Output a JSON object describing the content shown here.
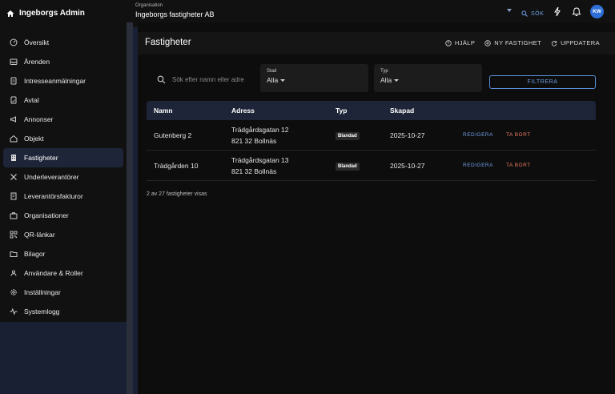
{
  "app": {
    "name": "Ingeborgs Admin"
  },
  "org": {
    "label": "Organisation",
    "name": "Ingeborgs fastigheter AB"
  },
  "topbar": {
    "search_label": "SÖK",
    "avatar_initials": "KW"
  },
  "sidebar": {
    "items": [
      {
        "label": "Översikt",
        "icon": "dashboard-icon"
      },
      {
        "label": "Ärenden",
        "icon": "inbox-icon"
      },
      {
        "label": "Intresseanmälningar",
        "icon": "document-icon"
      },
      {
        "label": "Avtal",
        "icon": "contract-icon"
      },
      {
        "label": "Annonser",
        "icon": "megaphone-icon"
      },
      {
        "label": "Objekt",
        "icon": "home-icon"
      },
      {
        "label": "Fastigheter",
        "icon": "building-icon",
        "active": true
      },
      {
        "label": "Underleverantörer",
        "icon": "tools-icon"
      },
      {
        "label": "Leverantörsfakturor",
        "icon": "invoice-icon"
      },
      {
        "label": "Organisationer",
        "icon": "briefcase-icon"
      },
      {
        "label": "QR-länkar",
        "icon": "qr-code-icon"
      },
      {
        "label": "Bilagor",
        "icon": "folder-icon"
      },
      {
        "label": "Användare & Roller",
        "icon": "users-icon"
      },
      {
        "label": "Inställningar",
        "icon": "settings-icon"
      },
      {
        "label": "Systemlogg",
        "icon": "activity-icon"
      }
    ]
  },
  "page": {
    "title": "Fastigheter",
    "actions": {
      "help": "HJÄLP",
      "new": "NY FASTIGHET",
      "refresh": "UPPDATERA"
    }
  },
  "filters": {
    "search_placeholder": "Sök efter namn eller adress",
    "city": {
      "label": "Stad",
      "value": "Alla"
    },
    "type": {
      "label": "Typ",
      "value": "Alla"
    },
    "filter_button": "FILTRERA"
  },
  "table": {
    "headers": {
      "name": "Namn",
      "address": "Adress",
      "type": "Typ",
      "created": "Skapad"
    },
    "rows": [
      {
        "name": "Gutenberg 2",
        "street": "Trädgårdsgatan 12",
        "city": "821 32 Bollnäs",
        "type": "Blandad",
        "created": "2025-10-27",
        "edit": "REDIGERA",
        "delete": "TA BORT"
      },
      {
        "name": "Trädgården 10",
        "street": "Trädgårdsgatan 13",
        "city": "821 32 Bollnäs",
        "type": "Blandad",
        "created": "2025-10-27",
        "edit": "REDIGERA",
        "delete": "TA BORT"
      }
    ]
  },
  "footer": {
    "count_text": "2 av 27 fastigheter visas"
  },
  "colors": {
    "accent": "#6fa0e8",
    "danger": "#e87a5c",
    "avatar": "#2f6fd8",
    "active_nav": "#1e2538"
  }
}
